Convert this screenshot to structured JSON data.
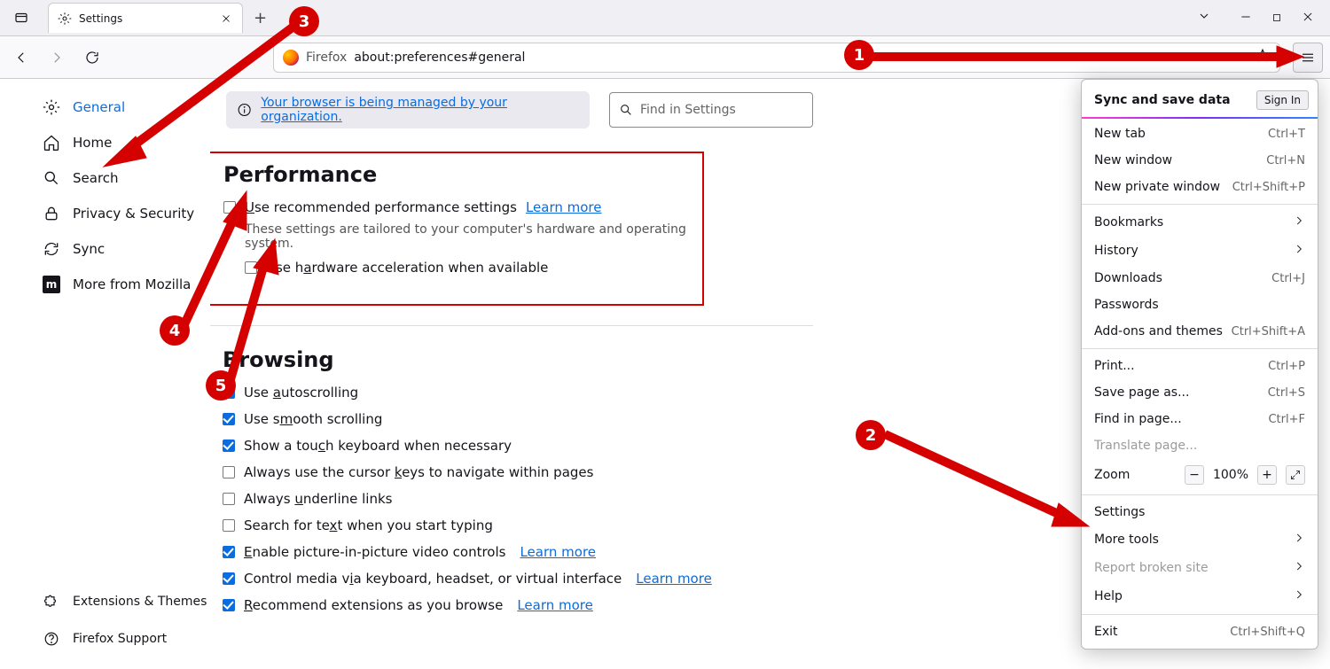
{
  "tab": {
    "title": "Settings"
  },
  "url": {
    "prefix": "Firefox",
    "value": "about:preferences#general"
  },
  "banner": {
    "text": "Your browser is being managed by your organization."
  },
  "search": {
    "placeholder": "Find in Settings"
  },
  "sidebar": {
    "items": [
      {
        "label": "General"
      },
      {
        "label": "Home"
      },
      {
        "label": "Search"
      },
      {
        "label": "Privacy & Security"
      },
      {
        "label": "Sync"
      },
      {
        "label": "More from Mozilla"
      }
    ],
    "bottom": [
      {
        "label": "Extensions & Themes"
      },
      {
        "label": "Firefox Support"
      }
    ]
  },
  "perf": {
    "title": "Performance",
    "recommended_pre": "U",
    "recommended_rest": "se recommended performance settings",
    "learn": "Learn more",
    "subtitle": "These settings are tailored to your computer's hardware and operating system.",
    "hw_pre_1": "Use h",
    "hw_under": "a",
    "hw_rest": "rdware acceleration when available"
  },
  "browsing": {
    "title": "Browsing",
    "items": [
      {
        "checked": true,
        "pre": "Use ",
        "u": "a",
        "post": "utoscrolling"
      },
      {
        "checked": true,
        "pre": "Use s",
        "u": "m",
        "post": "ooth scrolling"
      },
      {
        "checked": true,
        "pre": "Show a tou",
        "u": "c",
        "post": "h keyboard when necessary"
      },
      {
        "checked": false,
        "pre": "Always use the cursor ",
        "u": "k",
        "post": "eys to navigate within pages"
      },
      {
        "checked": false,
        "pre": "Always ",
        "u": "u",
        "post": "nderline links"
      },
      {
        "checked": false,
        "pre": "Search for te",
        "u": "x",
        "post": "t when you start typing"
      },
      {
        "checked": true,
        "pre": "",
        "u": "E",
        "post": "nable picture-in-picture video controls",
        "learn": "Learn more"
      },
      {
        "checked": true,
        "pre": "Control media v",
        "u": "i",
        "post": "a keyboard, headset, or virtual interface",
        "learn": "Learn more"
      },
      {
        "checked": true,
        "pre": "",
        "u": "R",
        "post": "ecommend extensions as you browse",
        "learn": "Learn more"
      }
    ]
  },
  "menu": {
    "sync_label": "Sync and save data",
    "sign_in": "Sign In",
    "rows1": [
      {
        "label": "New tab",
        "sc": "Ctrl+T"
      },
      {
        "label": "New window",
        "sc": "Ctrl+N"
      },
      {
        "label": "New private window",
        "sc": "Ctrl+Shift+P"
      }
    ],
    "rows2": [
      {
        "label": "Bookmarks",
        "chev": true
      },
      {
        "label": "History",
        "chev": true
      },
      {
        "label": "Downloads",
        "sc": "Ctrl+J"
      },
      {
        "label": "Passwords"
      },
      {
        "label": "Add-ons and themes",
        "sc": "Ctrl+Shift+A"
      }
    ],
    "rows3": [
      {
        "label": "Print...",
        "sc": "Ctrl+P"
      },
      {
        "label": "Save page as...",
        "sc": "Ctrl+S"
      },
      {
        "label": "Find in page...",
        "sc": "Ctrl+F"
      },
      {
        "label": "Translate page...",
        "disabled": true
      }
    ],
    "zoom_label": "Zoom",
    "zoom_value": "100%",
    "rows4": [
      {
        "label": "Settings"
      },
      {
        "label": "More tools",
        "chev": true
      },
      {
        "label": "Report broken site",
        "chev": true,
        "disabled": true
      },
      {
        "label": "Help",
        "chev": true
      }
    ],
    "exit": {
      "label": "Exit",
      "sc": "Ctrl+Shift+Q"
    }
  },
  "annotations": [
    "1",
    "2",
    "3",
    "4",
    "5"
  ]
}
